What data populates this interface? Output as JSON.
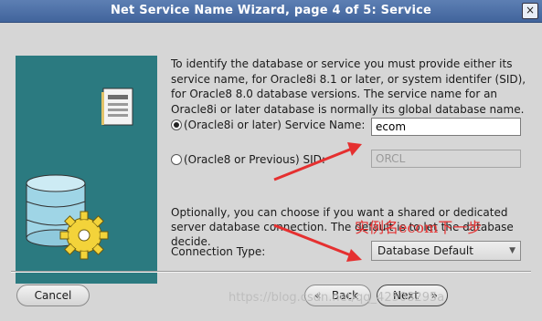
{
  "window": {
    "title": "Net Service Name Wizard, page 4 of 5: Service",
    "close_glyph": "×"
  },
  "intro_text": "To identify the database or service you must provide either its service name, for Oracle8i 8.1 or later, or system identifer (SID), for Oracle8 8.0 database versions. The service name for an Oracle8i or later database is normally its global database name.",
  "service_name_option": {
    "label": "(Oracle8i or later)  Service Name:",
    "value": "ecom",
    "selected": true
  },
  "sid_option": {
    "label": "(Oracle8 or Previous) SID:",
    "value": "ORCL",
    "selected": false
  },
  "connection_text": "Optionally, you can choose if you want a shared or dedicated server database connection. The default is to let the database decide.",
  "connection_type": {
    "label": "Connection Type:",
    "value": "Database Default"
  },
  "annotation": "实例名ecom下一步",
  "buttons": {
    "cancel": "Cancel",
    "back": "Back",
    "next": "Next"
  },
  "watermark": "https://blog.csdn.net/qq_42508295a",
  "colors": {
    "title_bar": "#4a6ea8",
    "art_panel": "#2b7a80",
    "annotation": "#e53030"
  }
}
